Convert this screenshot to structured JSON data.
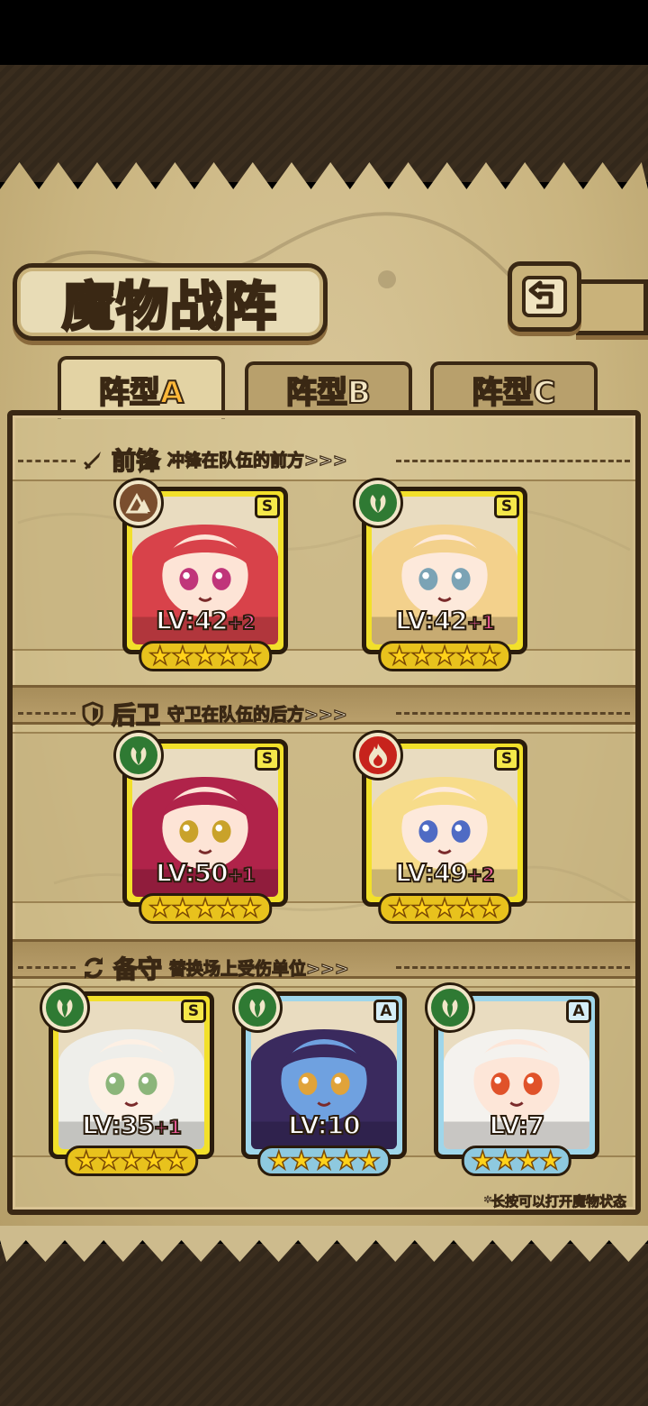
{
  "title": "魔物战阵",
  "tabs": [
    {
      "prefix": "阵型",
      "letter": "A",
      "active": true
    },
    {
      "prefix": "阵型",
      "letter": "B",
      "active": false
    },
    {
      "prefix": "阵型",
      "letter": "C",
      "active": false
    }
  ],
  "sections": {
    "front": {
      "name": "前锋",
      "desc": "冲锋在队伍的前方>>>",
      "icon": "sword-icon"
    },
    "back": {
      "name": "后卫",
      "desc": "守卫在队伍的后方>>>",
      "icon": "shield-icon"
    },
    "reserve": {
      "name": "备守",
      "desc": "替换场上受伤单位>>>",
      "icon": "swap-icon"
    }
  },
  "cards": {
    "front1": {
      "rank": "S",
      "element": "earth",
      "level": "LV:42",
      "plus": "+2",
      "stars": 5,
      "hair": "#d8424a",
      "skin": "#fde4d6",
      "eyes": "#c0357a"
    },
    "front2": {
      "rank": "S",
      "element": "wood",
      "level": "LV:42",
      "plus": "+1",
      "stars": 5,
      "hair": "#f3d18c",
      "skin": "#fde9db",
      "eyes": "#7ba3b5"
    },
    "back1": {
      "rank": "S",
      "element": "wood",
      "level": "LV:50",
      "plus": "+1",
      "stars": 5,
      "hair": "#b0234a",
      "skin": "#fde4d6",
      "eyes": "#c9a22a"
    },
    "back2": {
      "rank": "S",
      "element": "fire",
      "level": "LV:49",
      "plus": "+2",
      "stars": 5,
      "hair": "#f7dc8a",
      "skin": "#fde9db",
      "eyes": "#4f6bc4"
    },
    "res1": {
      "rank": "S",
      "element": "wood",
      "level": "LV:35",
      "plus": "+1",
      "stars": 5,
      "hair": "#eeeeea",
      "skin": "#fdf0e4",
      "eyes": "#8bb57a"
    },
    "res2": {
      "rank": "A",
      "element": "wood",
      "level": "LV:10",
      "plus": "",
      "stars": 5,
      "hair": "#3a2a5e",
      "skin": "#6fa1e0",
      "eyes": "#e0a33a"
    },
    "res3": {
      "rank": "A",
      "element": "wood",
      "level": "LV:7",
      "plus": "",
      "stars": 4,
      "hair": "#f4f2ee",
      "skin": "#fde6d8",
      "eyes": "#e0522a"
    }
  },
  "note": "*长按可以打开魔物状态"
}
